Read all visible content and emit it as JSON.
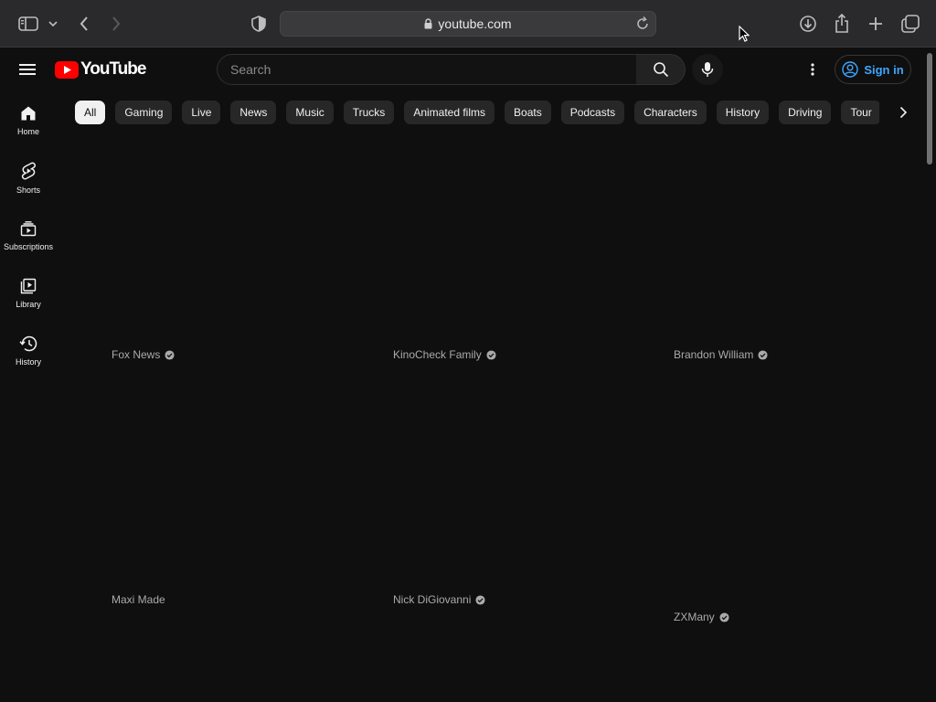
{
  "browser": {
    "url": "youtube.com"
  },
  "header": {
    "logo_text": "YouTube",
    "search_placeholder": "Search",
    "signin_label": "Sign in"
  },
  "sidebar": {
    "items": [
      {
        "label": "Home",
        "icon": "home-icon"
      },
      {
        "label": "Shorts",
        "icon": "shorts-icon"
      },
      {
        "label": "Subscriptions",
        "icon": "subscriptions-icon"
      },
      {
        "label": "Library",
        "icon": "library-icon"
      },
      {
        "label": "History",
        "icon": "history-icon"
      }
    ]
  },
  "chips": [
    "All",
    "Gaming",
    "Live",
    "News",
    "Music",
    "Trucks",
    "Animated films",
    "Boats",
    "Podcasts",
    "Characters",
    "History",
    "Driving",
    "Tour"
  ],
  "videos": [
    {
      "channel": "Fox News",
      "verified": true
    },
    {
      "channel": "KinoCheck Family",
      "verified": true
    },
    {
      "channel": "Brandon William",
      "verified": true
    },
    {
      "channel": "Maxi Made",
      "verified": false
    },
    {
      "channel": "Nick DiGiovanni",
      "verified": true
    },
    {
      "channel": "ZXMany",
      "verified": true
    }
  ],
  "colors": {
    "background": "#0f0f0f",
    "brand_red": "#ff0000",
    "signin_blue": "#3ea6ff"
  }
}
